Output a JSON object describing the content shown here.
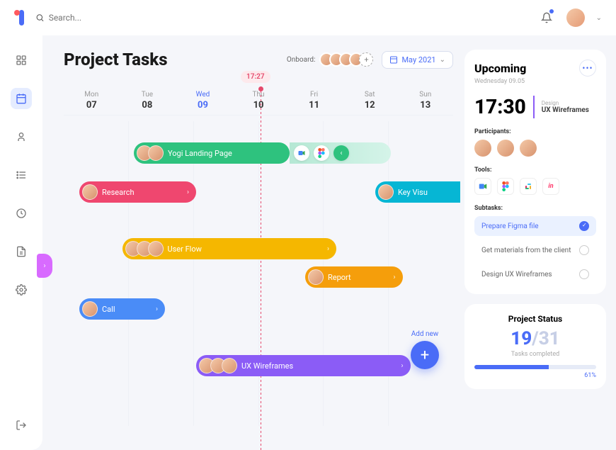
{
  "search": {
    "placeholder": "Search..."
  },
  "header": {
    "title": "Project Tasks",
    "onboard_label": "Onboard:",
    "month_picker": "May 2021",
    "current_time": "17:27"
  },
  "days": [
    {
      "name": "Mon",
      "num": "07"
    },
    {
      "name": "Tue",
      "num": "08"
    },
    {
      "name": "Wed",
      "num": "09",
      "active": true
    },
    {
      "name": "Thu",
      "num": "10"
    },
    {
      "name": "Fri",
      "num": "11"
    },
    {
      "name": "Sat",
      "num": "12"
    },
    {
      "name": "Sun",
      "num": "13"
    }
  ],
  "tasks": {
    "yogi": "Yogi Landing Page",
    "research": "Research",
    "keyvisual": "Key Visu",
    "userflow": "User Flow",
    "report": "Report",
    "call": "Call",
    "uxwf": "UX Wireframes"
  },
  "add_new_label": "Add new",
  "upcoming": {
    "title": "Upcoming",
    "date": "Wednesday 09.05",
    "time": "17:30",
    "task_category": "Design",
    "task_name": "UX Wireframes",
    "participants_label": "Participants:",
    "tools_label": "Tools:",
    "subtasks_label": "Subtasks:",
    "subtasks": [
      {
        "label": "Prepare Figma file",
        "done": true
      },
      {
        "label": "Get materials from the client",
        "done": false
      },
      {
        "label": "Design UX Wireframes",
        "done": false
      }
    ],
    "tools": [
      "meet",
      "figma",
      "slack",
      "invision"
    ]
  },
  "status": {
    "title": "Project Status",
    "done": "19",
    "total": "31",
    "sep": "/",
    "sub": "Tasks completed",
    "percent": "61%"
  },
  "icons": {
    "dashboard": "dashboard-icon",
    "calendar": "calendar-icon",
    "user": "user-icon",
    "list": "list-icon",
    "clock": "clock-icon",
    "file": "file-icon",
    "settings": "settings-icon",
    "logout": "logout-icon"
  }
}
